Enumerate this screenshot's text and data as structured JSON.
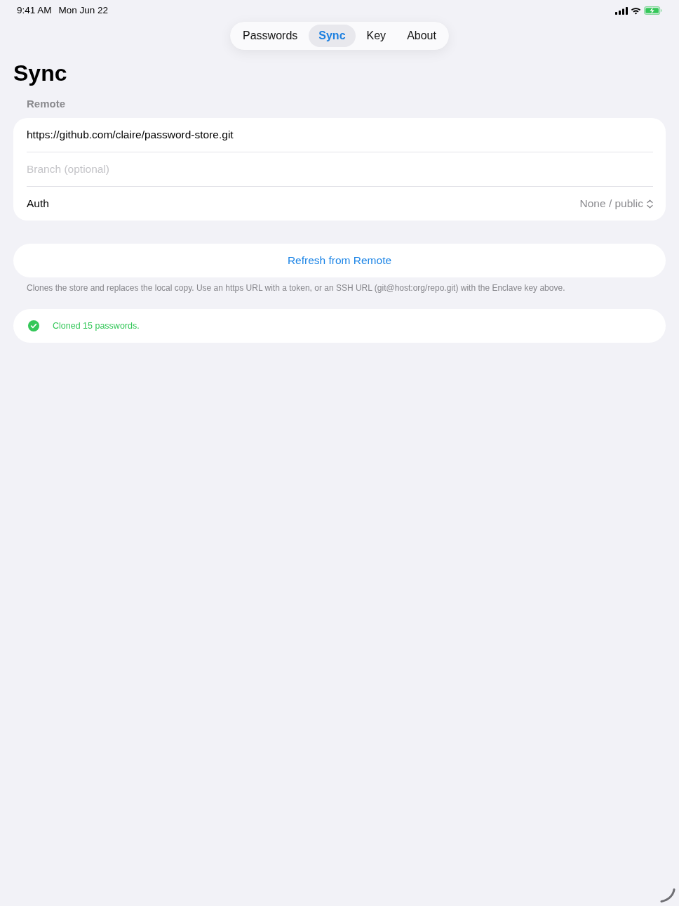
{
  "status_bar": {
    "time": "9:41 AM",
    "date": "Mon Jun 22"
  },
  "tabs": [
    {
      "label": "Passwords",
      "selected": false
    },
    {
      "label": "Sync",
      "selected": true
    },
    {
      "label": "Key",
      "selected": false
    },
    {
      "label": "About",
      "selected": false
    }
  ],
  "title": "Sync",
  "remote": {
    "header": "Remote",
    "rows": [
      {
        "kind": "field",
        "value": "https://github.com/claire/password-store.git"
      },
      {
        "kind": "field",
        "placeholder": "Branch (optional)"
      },
      {
        "kind": "picker",
        "label": "Auth",
        "value": "None / public"
      }
    ]
  },
  "refresh_button": {
    "label": "Refresh from Remote"
  },
  "footer": "Clones the store and replaces the local copy. Use an https URL with a token, or an SSH URL (git@host:org/repo.git) with the Enclave key above.",
  "status_message": {
    "kind": "success",
    "text": "Cloned 15 passwords."
  }
}
